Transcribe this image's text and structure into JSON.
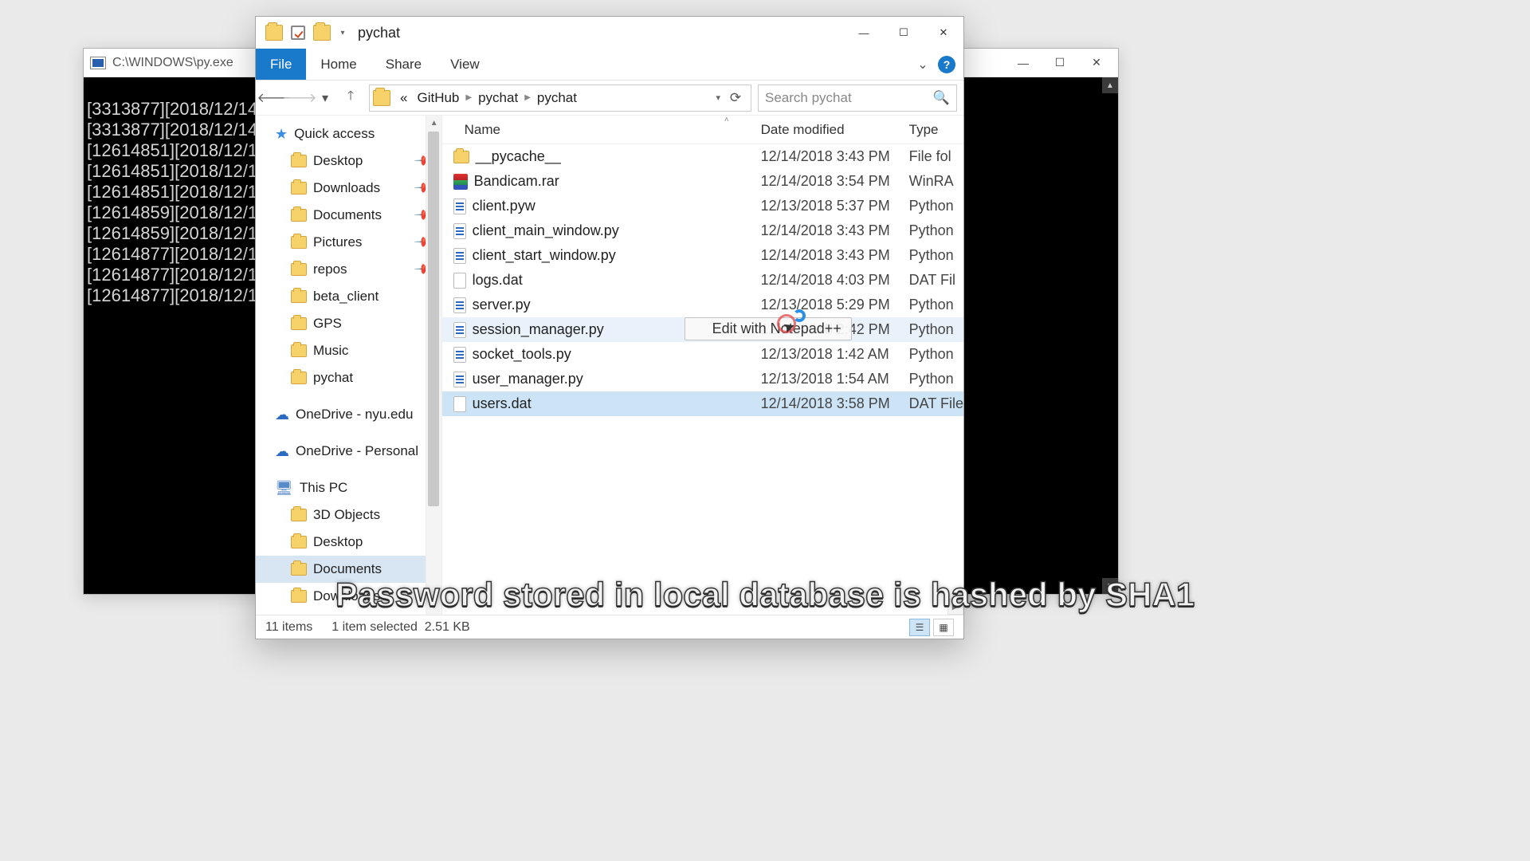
{
  "terminal": {
    "title": "C:\\WINDOWS\\py.exe",
    "lines": [
      "[3313877][2018/12/14",
      "[3313877][2018/12/14",
      "[12614851][2018/12/1",
      "[12614851][2018/12/1",
      "[12614851][2018/12/1",
      "[12614859][2018/12/1",
      "[12614859][2018/12/1",
      "[12614877][2018/12/1",
      "[12614877][2018/12/1",
      "[12614877][2018/12/1"
    ]
  },
  "explorer": {
    "title": "pychat",
    "ribbon": {
      "file": "File",
      "home": "Home",
      "share": "Share",
      "view": "View"
    },
    "breadcrumb": {
      "root_sep": "«",
      "a": "GitHub",
      "b": "pychat",
      "c": "pychat"
    },
    "search_placeholder": "Search pychat",
    "columns": {
      "name": "Name",
      "date": "Date modified",
      "type": "Type"
    },
    "sidebar": {
      "quick_access": "Quick access",
      "desktop": "Desktop",
      "downloads": "Downloads",
      "documents": "Documents",
      "pictures": "Pictures",
      "repos": "repos",
      "beta_client": "beta_client",
      "gps": "GPS",
      "music": "Music",
      "pychat": "pychat",
      "onedrive_nyu": "OneDrive - nyu.edu",
      "onedrive_personal": "OneDrive - Personal",
      "this_pc": "This PC",
      "objects3d": "3D Objects",
      "desktop2": "Desktop",
      "documents2": "Documents",
      "downloads2": "Downloads"
    },
    "files": [
      {
        "name": "__pycache__",
        "date": "12/14/2018 3:43 PM",
        "type": "File fol",
        "icon": "folder"
      },
      {
        "name": "Bandicam.rar",
        "date": "12/14/2018 3:54 PM",
        "type": "WinRA",
        "icon": "rar"
      },
      {
        "name": "client.pyw",
        "date": "12/13/2018 5:37 PM",
        "type": "Python",
        "icon": "py"
      },
      {
        "name": "client_main_window.py",
        "date": "12/14/2018 3:43 PM",
        "type": "Python",
        "icon": "py"
      },
      {
        "name": "client_start_window.py",
        "date": "12/14/2018 3:43 PM",
        "type": "Python",
        "icon": "py"
      },
      {
        "name": "logs.dat",
        "date": "12/14/2018 4:03 PM",
        "type": "DAT Fil",
        "icon": "dat"
      },
      {
        "name": "server.py",
        "date": "12/13/2018 5:29 PM",
        "type": "Python",
        "icon": "py"
      },
      {
        "name": "session_manager.py",
        "date": "12/12/2018 2:42 PM",
        "type": "Python",
        "icon": "py"
      },
      {
        "name": "socket_tools.py",
        "date": "12/13/2018 1:42 AM",
        "type": "Python",
        "icon": "py"
      },
      {
        "name": "user_manager.py",
        "date": "12/13/2018 1:54 AM",
        "type": "Python",
        "icon": "py"
      },
      {
        "name": "users.dat",
        "date": "12/14/2018 3:58 PM",
        "type": "DAT File",
        "icon": "dat"
      }
    ],
    "context_tooltip": "Edit with Notepad++",
    "status": {
      "items": "11 items",
      "selected": "1 item selected",
      "size": "2.51 KB"
    }
  },
  "caption": "Password stored in local database is hashed by SHA1"
}
